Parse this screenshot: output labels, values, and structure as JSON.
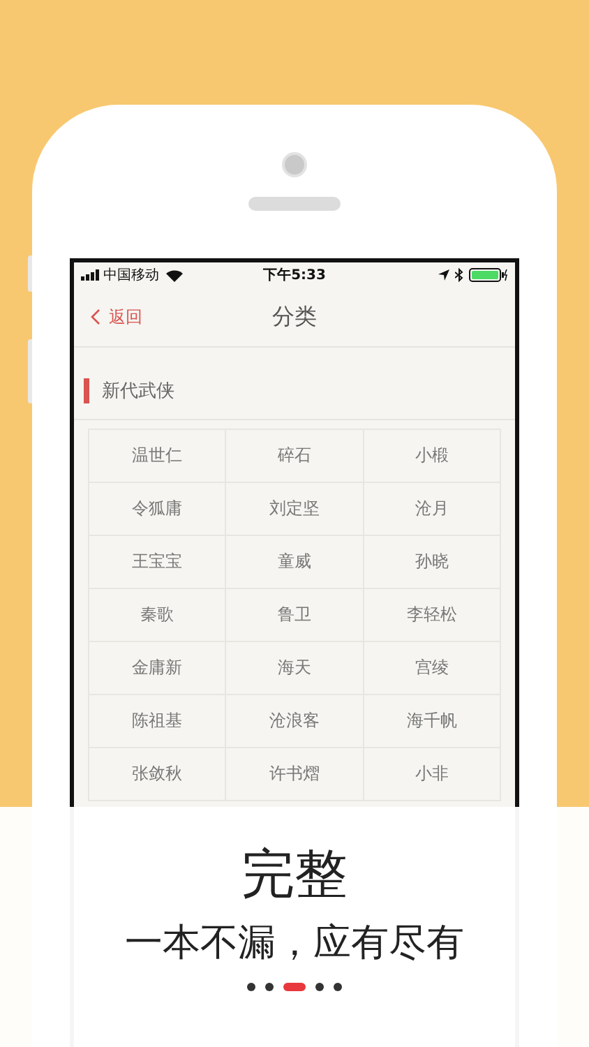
{
  "status_bar": {
    "carrier": "中国移动",
    "time": "下午5:33"
  },
  "nav": {
    "back": "返回",
    "title": "分类"
  },
  "section": {
    "title": "新代武侠"
  },
  "authors": [
    [
      "温世仁",
      "碎石",
      "小椴"
    ],
    [
      "令狐庸",
      "刘定坚",
      "沧月"
    ],
    [
      "王宝宝",
      "童威",
      "孙晓"
    ],
    [
      "秦歌",
      "鲁卫",
      "李轻松"
    ],
    [
      "金庸新",
      "海天",
      "宫绫"
    ],
    [
      "陈祖基",
      "沧浪客",
      "海千帆"
    ],
    [
      "张敛秋",
      "许书熠",
      "小非"
    ]
  ],
  "promo": {
    "title": "完整",
    "subtitle": "一本不漏，应有尽有"
  },
  "pager": [
    {
      "selected": false
    },
    {
      "selected": false
    },
    {
      "selected": true
    },
    {
      "selected": false
    },
    {
      "selected": false
    }
  ]
}
